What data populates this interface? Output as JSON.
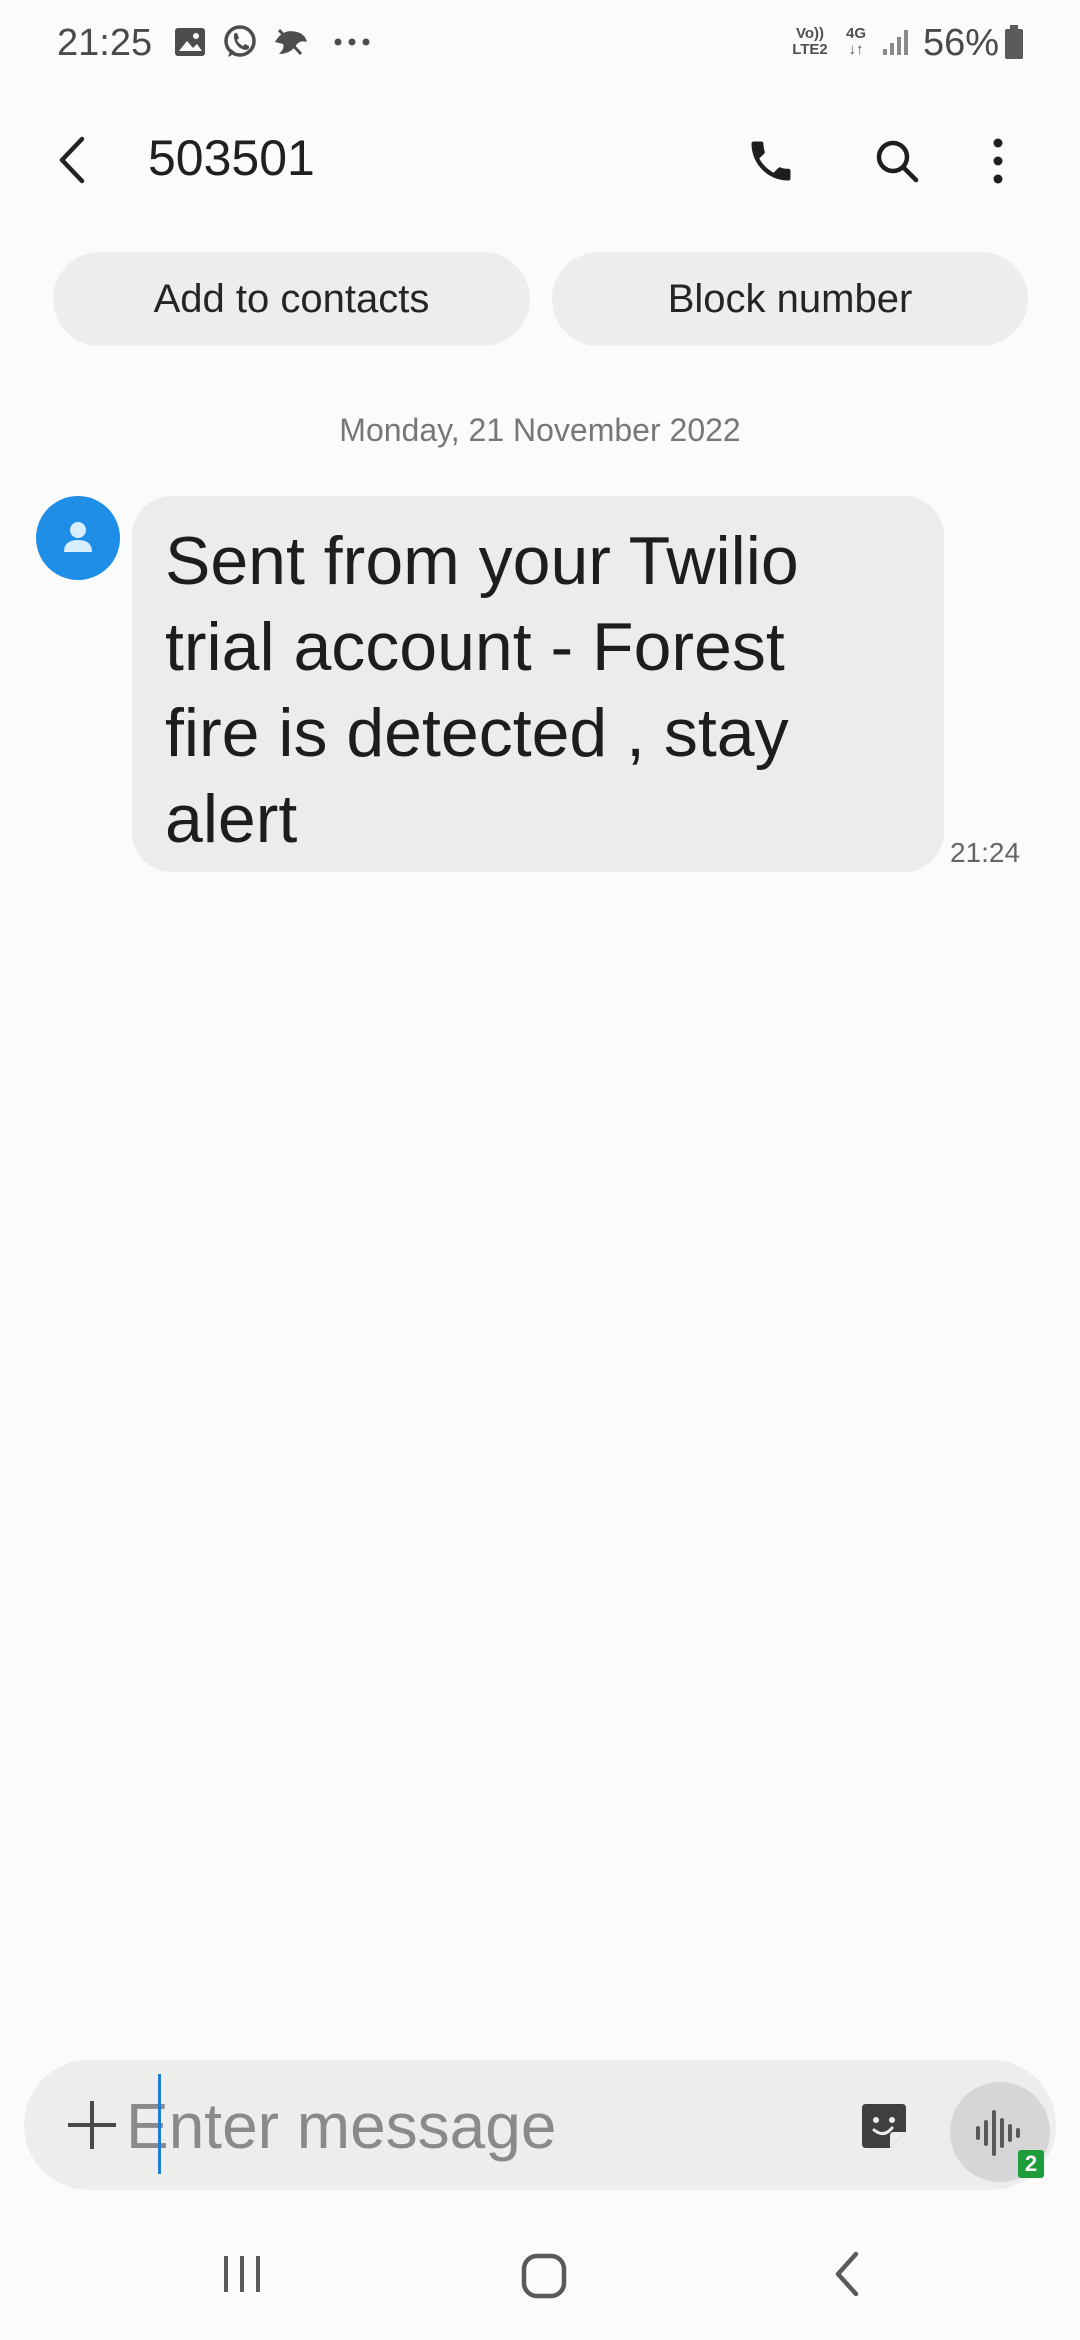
{
  "status_bar": {
    "time": "21:25",
    "battery_percent": "56%",
    "network_volte_line1": "Vo))",
    "network_volte_line2": "LTE2",
    "network_type": "4G",
    "notification_icons": [
      "gallery-icon",
      "whatsapp-icon",
      "bird-app-icon",
      "more-notifications-icon"
    ],
    "signal_icon": "signal-icon",
    "battery_icon": "battery-icon"
  },
  "header": {
    "title": "503501",
    "back_icon": "back-arrow-icon",
    "actions": [
      "call-icon",
      "search-icon",
      "more-options-icon"
    ]
  },
  "chips": {
    "add_to_contacts": "Add to contacts",
    "block_number": "Block number"
  },
  "conversation": {
    "date": "Monday, 21 November 2022",
    "messages": [
      {
        "lines": [
          "Sent from your Twilio",
          "trial account - Forest",
          "fire is detected , stay",
          "alert"
        ],
        "time": "21:24",
        "sender_icon": "contact-avatar-icon"
      }
    ]
  },
  "composer": {
    "placeholder": "Enter message",
    "value": "",
    "attach_icon": "plus-icon",
    "sticker_icon": "sticker-icon",
    "voice_icon": "voice-input-icon",
    "sim_badge": "2",
    "sim_badge_color": "#1f9d3a"
  },
  "nav_bar": {
    "recents_icon": "recents-icon",
    "home_icon": "home-icon",
    "back_icon": "nav-back-icon"
  },
  "colors": {
    "accent": "#1e8ee6",
    "bubble": "#ececec",
    "background": "#fbfbfb"
  }
}
